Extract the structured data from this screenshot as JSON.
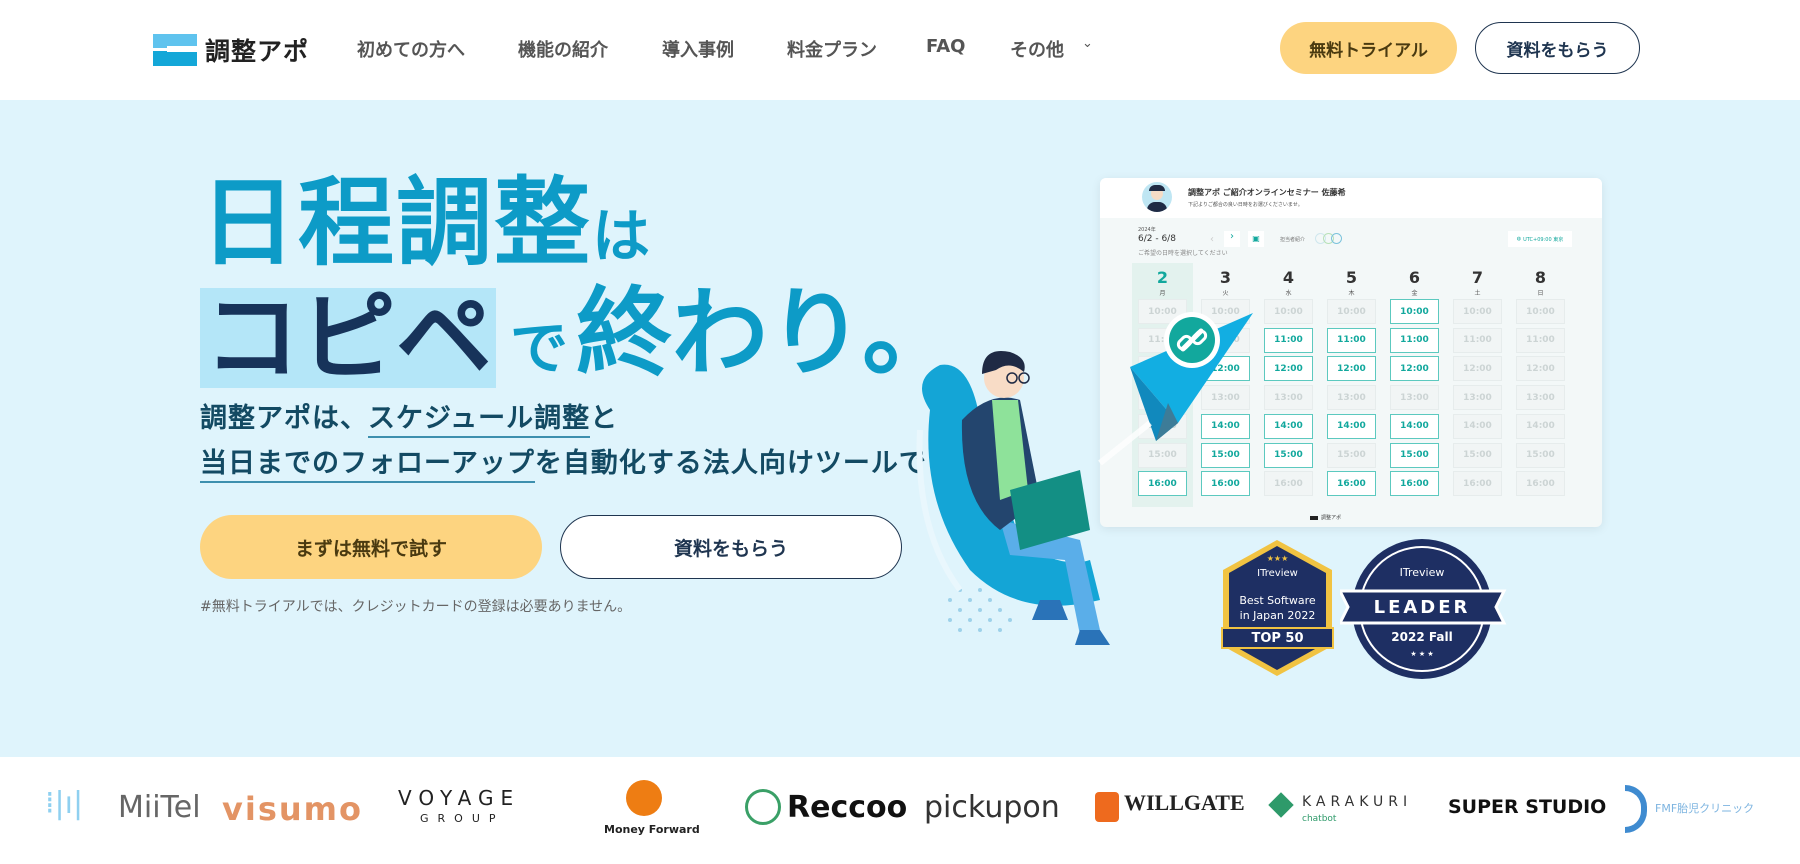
{
  "header": {
    "logo_text": "調整アポ",
    "nav": [
      {
        "label": "初めての方へ"
      },
      {
        "label": "機能の紹介"
      },
      {
        "label": "導入事例"
      },
      {
        "label": "料金プラン"
      },
      {
        "label": "FAQ"
      },
      {
        "label": "その他"
      }
    ],
    "trial_button": "無料トライアル",
    "docs_button": "資料をもらう"
  },
  "hero": {
    "title_line1_main": "日程調整",
    "title_line1_small": "は",
    "title_line2_highlight": "コピペ",
    "title_line2_small": "で",
    "title_line2_rest": "終わり。",
    "sub_line1_a": "調整アポは、",
    "sub_line1_u": "スケジュール調整",
    "sub_line1_b": "と",
    "sub_line2_u": "当日までのフォローアップ",
    "sub_line2_b": "を自動化する法人向けツールです。",
    "cta_primary": "まずは無料で試す",
    "cta_secondary": "資料をもらう",
    "note": "#無料トライアルでは、クレジットカードの登録は必要ありません。"
  },
  "calendar": {
    "title": "調整アポ ご紹介オンラインセミナー 佐藤希",
    "subtitle": "下記よりご都合の良い日時をお選びくださいませ。",
    "year": "2024年",
    "range": "6/2 - 6/8",
    "instruction": "ご希望の日時を選択してください",
    "staff_label": "担当者紹介",
    "timezone": "UTC+09:00 東京",
    "footer": "調整アポ",
    "accent": "#12a89d",
    "times": [
      "10:00",
      "11:00",
      "12:00",
      "13:00",
      "14:00",
      "15:00",
      "16:00"
    ],
    "days": [
      {
        "num": "2",
        "label": "月",
        "slots": [
          0,
          0,
          0,
          0,
          0,
          0,
          1
        ]
      },
      {
        "num": "3",
        "label": "火",
        "slots": [
          0,
          0,
          1,
          0,
          1,
          1,
          1
        ]
      },
      {
        "num": "4",
        "label": "水",
        "slots": [
          0,
          1,
          1,
          0,
          1,
          1,
          0
        ]
      },
      {
        "num": "5",
        "label": "木",
        "slots": [
          0,
          1,
          1,
          0,
          1,
          0,
          1
        ]
      },
      {
        "num": "6",
        "label": "金",
        "slots": [
          1,
          1,
          1,
          0,
          1,
          1,
          1
        ]
      },
      {
        "num": "7",
        "label": "土",
        "slots": [
          0,
          0,
          0,
          0,
          0,
          0,
          0
        ]
      },
      {
        "num": "8",
        "label": "日",
        "slots": [
          0,
          0,
          0,
          0,
          0,
          0,
          0
        ]
      }
    ]
  },
  "badges": {
    "b1_brand": "ITreview",
    "b1_l1": "Best Software",
    "b1_l2": "in Japan 2022",
    "b1_l3": "TOP 50",
    "b2_brand": "ITreview",
    "b2_l1": "LEADER",
    "b2_l2": "2022 Fall"
  },
  "logos": [
    "MiiTel",
    "visumo",
    "VOYAGE",
    "GROUP",
    "Money Forward",
    "Reccoo",
    "pickupon",
    "WILLGATE",
    "KARAKURI",
    "chatbot",
    "SUPER STUDIO",
    "FMF胎児クリニック"
  ],
  "colors": {
    "brand": "#0d9bc7",
    "hero_bg": "#dff4fc",
    "cta": "#fdd480",
    "navy": "#17335a"
  }
}
